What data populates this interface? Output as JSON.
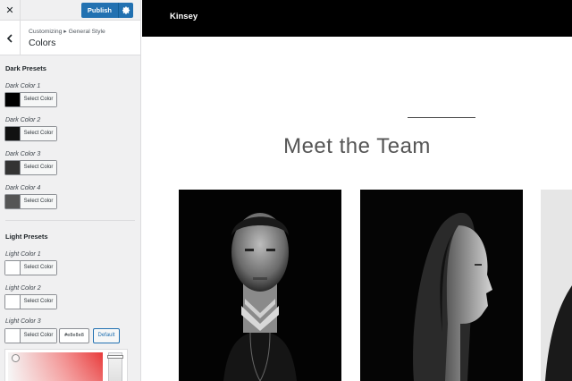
{
  "customizer": {
    "close_glyph": "✕",
    "publish_label": "Publish",
    "breadcrumb": "Customizing ▸ General Style",
    "section_title": "Colors",
    "dark_presets": {
      "title": "Dark Presets",
      "items": [
        {
          "label": "Dark Color 1",
          "button": "Select Color",
          "color": "#000000"
        },
        {
          "label": "Dark Color 2",
          "button": "Select Color",
          "color": "#111111"
        },
        {
          "label": "Dark Color 3",
          "button": "Select Color",
          "color": "#333333"
        },
        {
          "label": "Dark Color 4",
          "button": "Select Color",
          "color": "#555555"
        }
      ]
    },
    "light_presets": {
      "title": "Light Presets",
      "items": [
        {
          "label": "Light Color 1",
          "button": "Select Color",
          "color": "#ffffff"
        },
        {
          "label": "Light Color 2",
          "button": "Select Color",
          "color": "#ffffff"
        },
        {
          "label": "Light Color 3",
          "button": "Select Color",
          "color": "#ffffff",
          "hex": "#e8e8e8",
          "default_label": "Default"
        }
      ]
    },
    "accent_color": "#2271b1"
  },
  "preview": {
    "site_title": "Kinsey",
    "heading": "Meet the Team",
    "header_bg": "#000000"
  }
}
